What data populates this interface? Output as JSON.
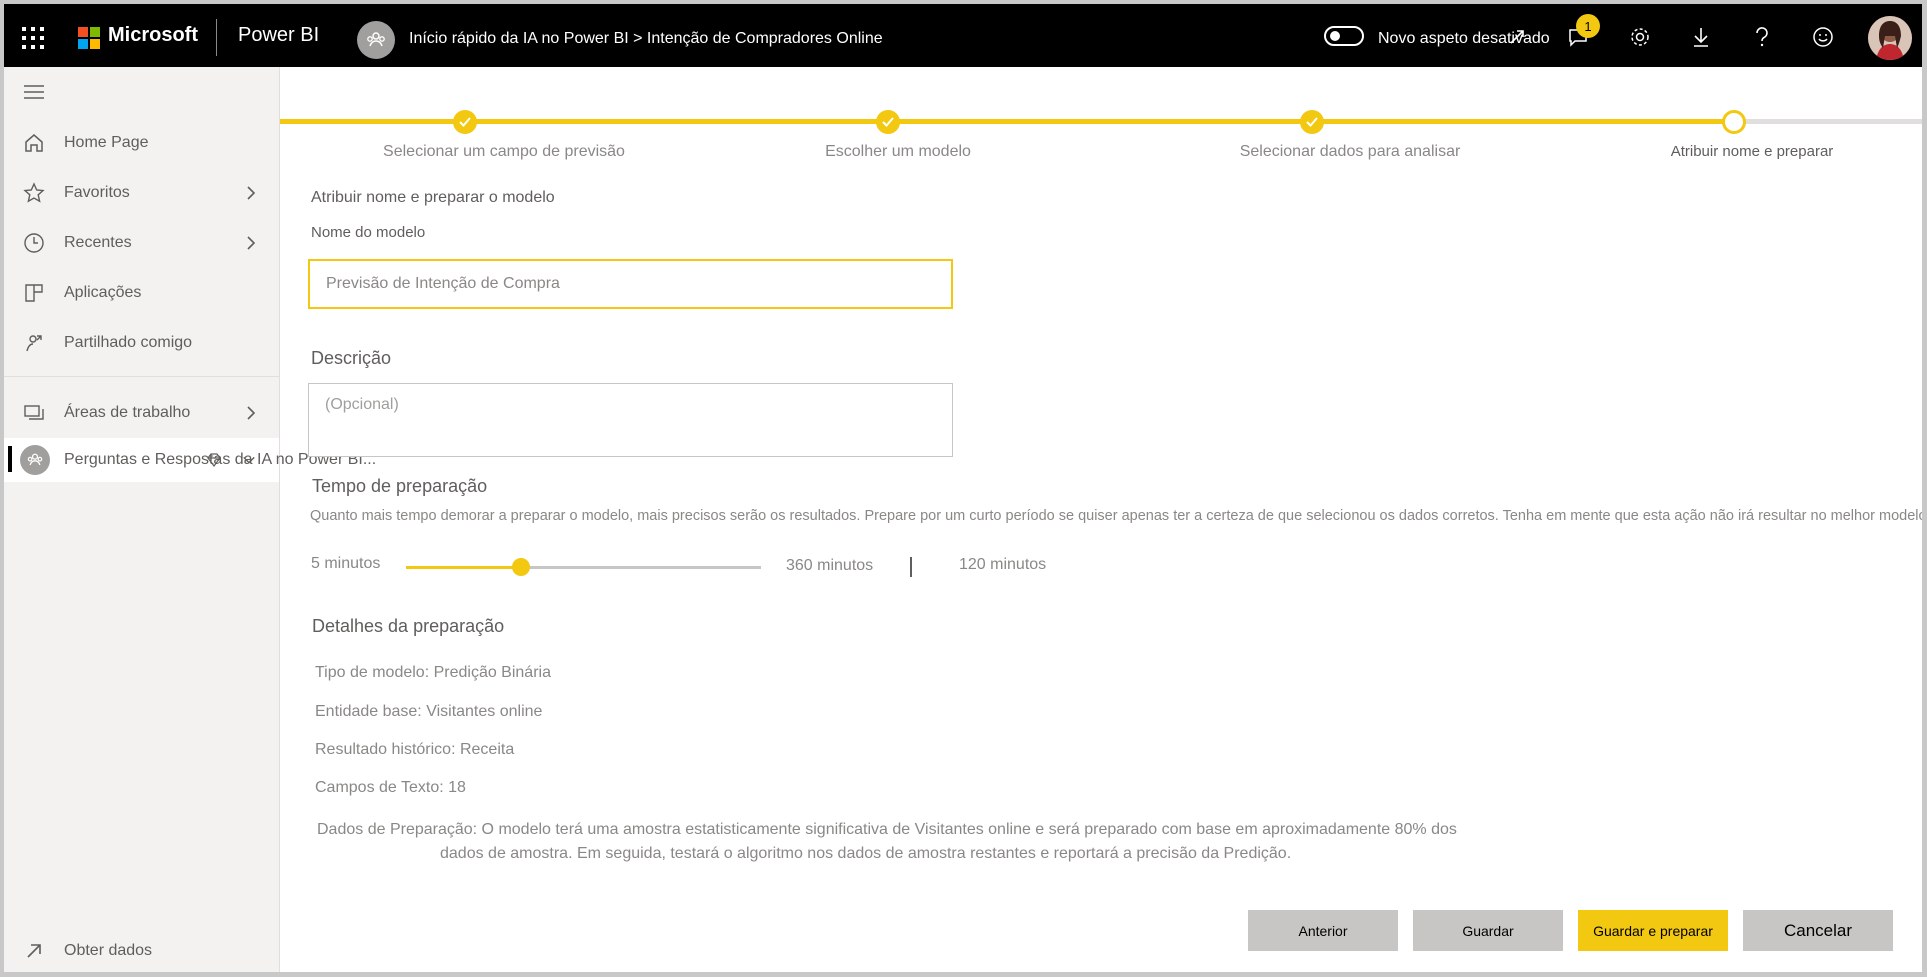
{
  "topbar": {
    "brand": "Microsoft",
    "product": "Power BI",
    "breadcrumb": "Início rápido da IA no Power BI > Intenção de Compradores Online",
    "toggle_label": "Novo aspeto desativado",
    "notification_count": "1"
  },
  "sidebar": {
    "items": [
      {
        "label": "Home Page",
        "icon": "home-icon"
      },
      {
        "label": "Favoritos",
        "icon": "star-icon"
      },
      {
        "label": "Recentes",
        "icon": "clock-icon"
      },
      {
        "label": "Aplicações",
        "icon": "apps-icon"
      },
      {
        "label": "Partilhado comigo",
        "icon": "shared-icon"
      },
      {
        "label": "Áreas de trabalho",
        "icon": "workspaces-icon"
      },
      {
        "label": "Perguntas e Respostas da IA no Power BI...",
        "icon": "workspace-avatar-icon"
      }
    ],
    "get_data": "Obter dados"
  },
  "stepper": {
    "steps": [
      {
        "label": "Selecionar um campo de previsão",
        "state": "done"
      },
      {
        "label": "Escolher um modelo",
        "state": "done"
      },
      {
        "label": "Selecionar dados para analisar",
        "state": "done"
      },
      {
        "label": "Atribuir nome e preparar",
        "state": "current"
      }
    ]
  },
  "form": {
    "section_title": "Atribuir nome e preparar o modelo",
    "name_label": "Nome do modelo",
    "name_value": "Previsão de Intenção de Compra",
    "description_label": "Descrição",
    "description_placeholder": "(Opcional)",
    "training_time_title": "Tempo de preparação",
    "training_time_desc": "Quanto mais tempo demorar a preparar o modelo, mais precisos serão os resultados. Prepare por um curto período se quiser apenas ter a certeza de que selecionou os dados corretos. Tenha em mente que esta ação não irá resultar no melhor modelo.",
    "slider_min_label": "5 minutos",
    "slider_max_label": "360 minutos",
    "slider_value_label": "120 minutos",
    "slider_min": 5,
    "slider_max": 360,
    "slider_value": 120
  },
  "details": {
    "title": "Detalhes da preparação",
    "model_type": "Tipo de modelo: Predição Binária",
    "base_entity": "Entidade base: Visitantes online",
    "historical_outcome": "Resultado histórico: Receita",
    "text_fields": "Campos de Texto: 18",
    "training_data_line1": "Dados de Preparação: O modelo terá uma amostra estatisticamente significativa de Visitantes online e será preparado com base em aproximadamente 80% dos",
    "training_data_line2": "dados de amostra. Em seguida, testará o algoritmo nos dados de amostra restantes e reportará a precisão da Predição."
  },
  "buttons": {
    "previous": "Anterior",
    "save": "Guardar",
    "save_and_train": "Guardar e preparar",
    "cancel": "Cancelar"
  },
  "colors": {
    "accent": "#f2c811",
    "topbar_bg": "#000000",
    "sidebar_bg": "#f3f2f1",
    "button_grey": "#c8c6c4"
  }
}
